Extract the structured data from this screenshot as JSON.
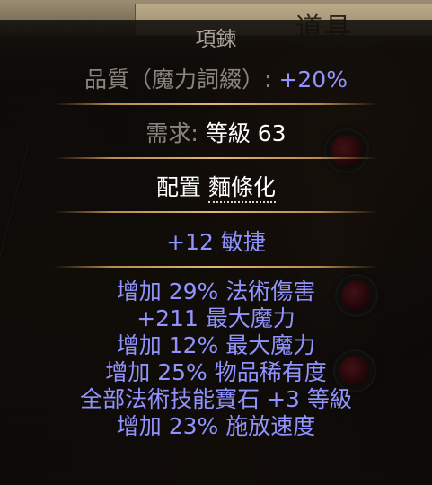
{
  "window": {
    "panel_title": "道具"
  },
  "item": {
    "name": "項鍊",
    "quality_label": "品質（魔力詞綴）",
    "quality_sep": ":",
    "quality_value": "+20%",
    "requirement_label": "需求:",
    "requirement_value": "等級 63",
    "config_label": "配置",
    "config_value": "麵條化",
    "implicit_mod": "+12 敏捷",
    "explicit_mods": [
      "增加 29% 法術傷害",
      "+211 最大魔力",
      "增加 12% 最大魔力",
      "增加 25% 物品稀有度",
      "全部法術技能寶石 +3 等級",
      "增加 23% 施放速度"
    ]
  },
  "colors": {
    "magic_text": "#9193ff",
    "label_grey": "#8a8580",
    "value_white": "#ffffff",
    "separator_gold": "#e0b878"
  }
}
